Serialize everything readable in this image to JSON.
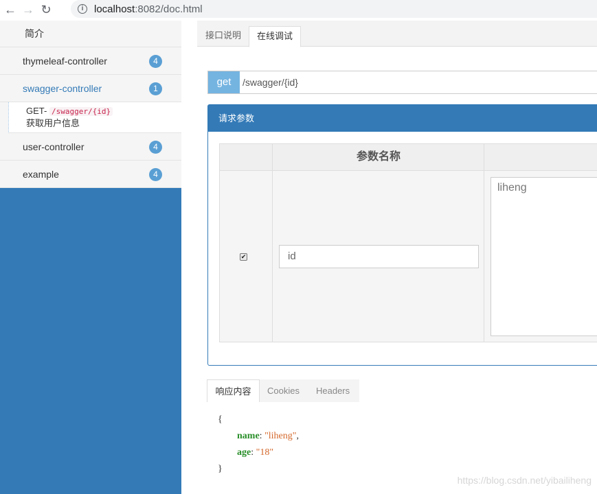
{
  "browser": {
    "url_host": "localhost",
    "url_path": ":8082/doc.html"
  },
  "sidebar": {
    "intro": "简介",
    "items": [
      {
        "label": "thymeleaf-controller",
        "count": "4"
      },
      {
        "label": "swagger-controller",
        "count": "1"
      },
      {
        "label": "user-controller",
        "count": "4"
      },
      {
        "label": "example",
        "count": "4"
      }
    ],
    "sub_item": {
      "method": "GET-",
      "path": "/swagger/{id}",
      "desc": "获取用户信息"
    }
  },
  "tabs": {
    "doc": "接口说明",
    "debug": "在线调试"
  },
  "request": {
    "method": "get",
    "path": "/swagger/{id}"
  },
  "params_panel": {
    "title": "请求参数",
    "header_name": "参数名称",
    "row": {
      "checked": true,
      "name": "id",
      "value": "liheng"
    }
  },
  "response_tabs": {
    "content": "响应内容",
    "cookies": "Cookies",
    "headers": "Headers"
  },
  "response_json": {
    "open": "{",
    "close": "}",
    "fields": [
      {
        "key": "name",
        "value": "\"liheng\"",
        "sep": ","
      },
      {
        "key": "age",
        "value": "\"18\"",
        "sep": ""
      }
    ]
  },
  "watermark": "https://blog.csdn.net/yibailiheng",
  "colors": {
    "primary": "#337ab7",
    "method_bg": "#74b4e1",
    "badge": "#5a9fd4"
  }
}
